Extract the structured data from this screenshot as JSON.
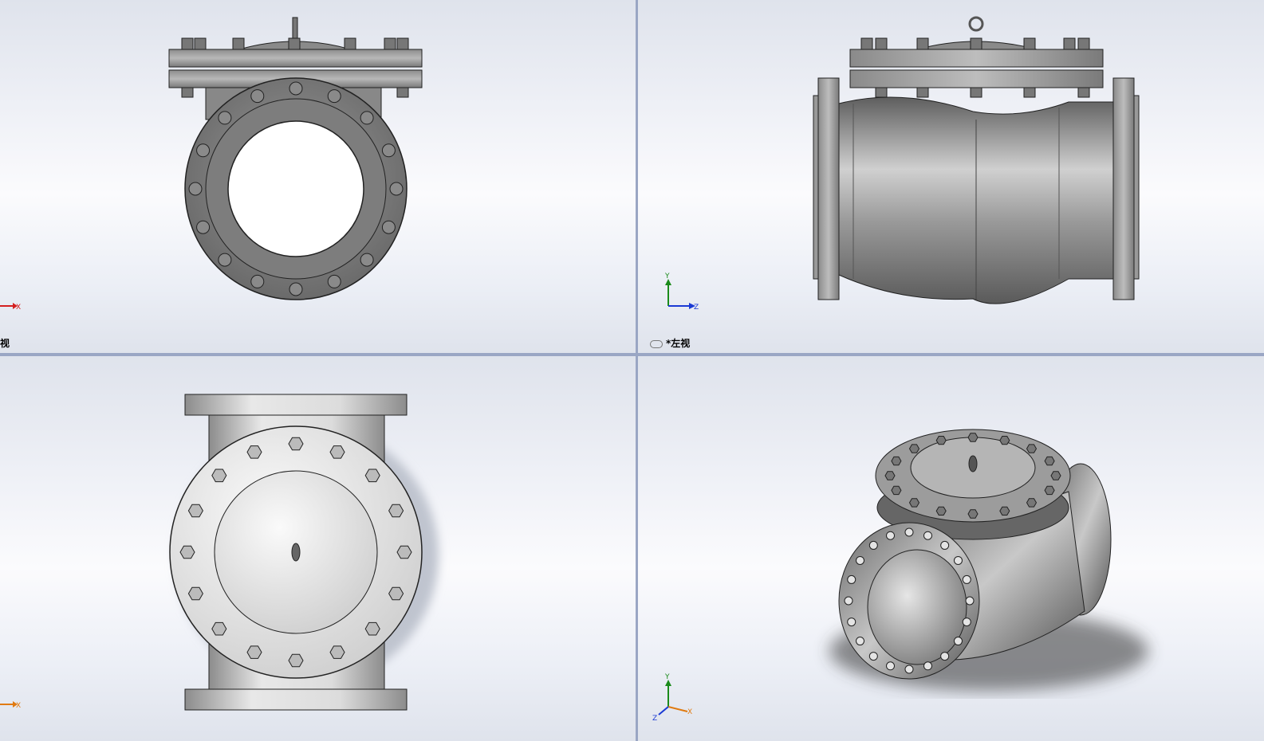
{
  "viewports": {
    "front": {
      "label": "前视"
    },
    "left": {
      "label": "*左视"
    },
    "top": {
      "label": ""
    },
    "iso": {
      "label": ""
    }
  },
  "triad": {
    "x": "X",
    "y": "Y",
    "z": "Z",
    "colors": {
      "x": "#d42020",
      "y": "#1a8a1a",
      "z": "#1a3ad4",
      "x_alt": "#e07a10"
    }
  },
  "colors": {
    "metal_dark": "#6a6a6a",
    "metal_mid": "#9a9a9a",
    "metal_light": "#d8d8d8",
    "splitter": "#9aa6c4"
  }
}
